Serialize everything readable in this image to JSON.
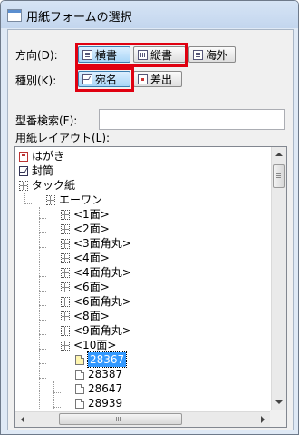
{
  "window": {
    "title": "用紙フォームの選択"
  },
  "direction": {
    "label": "方向(D):",
    "options": [
      {
        "label": "横書",
        "icon": "horizontal-writing-icon",
        "pressed": true
      },
      {
        "label": "縦書",
        "icon": "vertical-writing-icon",
        "pressed": false
      },
      {
        "label": "海外",
        "icon": "overseas-icon",
        "pressed": false
      }
    ]
  },
  "kind": {
    "label": "種別(K):",
    "options": [
      {
        "label": "宛名",
        "icon": "envelope-icon",
        "pressed": true
      },
      {
        "label": "差出",
        "icon": "sender-icon",
        "pressed": false
      }
    ]
  },
  "search": {
    "label": "型番検索(F):",
    "value": ""
  },
  "layout": {
    "label": "用紙レイアウト(L):"
  },
  "tree": {
    "nodes": [
      {
        "text": "はがき",
        "icon": "postcard-icon",
        "selected": false
      },
      {
        "text": "封筒",
        "icon": "envelope-icon",
        "selected": false
      },
      {
        "text": "タック紙",
        "icon": "label-sheet-icon",
        "selected": false
      },
      {
        "text": "エーワン",
        "icon": "label-sheet-icon",
        "selected": false
      },
      {
        "text": "<1面>",
        "icon": "label-sheet-icon",
        "selected": false
      },
      {
        "text": "<2面>",
        "icon": "label-sheet-icon",
        "selected": false
      },
      {
        "text": "<3面角丸>",
        "icon": "label-sheet-icon",
        "selected": false
      },
      {
        "text": "<4面>",
        "icon": "label-sheet-icon",
        "selected": false
      },
      {
        "text": "<4面角丸>",
        "icon": "label-sheet-icon",
        "selected": false
      },
      {
        "text": "<6面>",
        "icon": "label-sheet-icon",
        "selected": false
      },
      {
        "text": "<6面角丸>",
        "icon": "label-sheet-icon",
        "selected": false
      },
      {
        "text": "<8面>",
        "icon": "label-sheet-icon",
        "selected": false
      },
      {
        "text": "<9面角丸>",
        "icon": "label-sheet-icon",
        "selected": false
      },
      {
        "text": "<10面>",
        "icon": "label-sheet-icon",
        "selected": false
      },
      {
        "text": "28367",
        "icon": "page-icon",
        "selected": true
      },
      {
        "text": "28387",
        "icon": "page-icon",
        "selected": false
      },
      {
        "text": "28647",
        "icon": "page-icon",
        "selected": false
      },
      {
        "text": "28939",
        "icon": "page-icon",
        "selected": false
      }
    ]
  },
  "colors": {
    "highlight": "#e00010",
    "selection": "#3399ff"
  }
}
